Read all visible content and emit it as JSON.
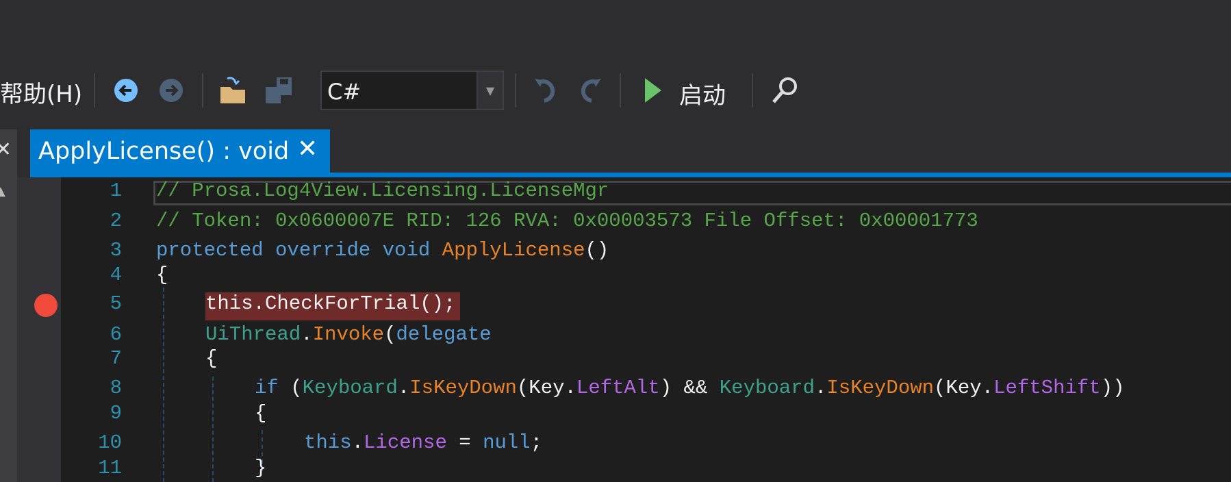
{
  "menu": {
    "help_label": "帮助(H)"
  },
  "toolbar": {
    "language_value": "C#",
    "start_label": "启动",
    "icons": [
      "back-icon",
      "forward-icon",
      "open-folder-icon",
      "save-icon",
      "undo-icon",
      "redo-icon",
      "play-icon",
      "search-icon"
    ]
  },
  "tab": {
    "title": "ApplyLicense() : void",
    "close_label": "✕"
  },
  "side": {
    "close_label": "✕",
    "up_label": "▲"
  },
  "colors": {
    "accent": "#007acc",
    "comment": "#57a64a",
    "keyword": "#569cd6",
    "method": "#e8832a",
    "type": "#4ec9b0",
    "property": "#b267e6",
    "line_number": "#2b91af",
    "breakpoint": "#f04a3a"
  },
  "code": {
    "breakpoint_line": 5,
    "lines": [
      {
        "n": "1",
        "indent": 0,
        "tokens": [
          {
            "t": "// Prosa.Log4View.Licensing.LicenseMgr",
            "c": "cm"
          }
        ]
      },
      {
        "n": "2",
        "indent": 0,
        "tokens": [
          {
            "t": "// Token: 0x0600007E RID: 126 RVA: 0x00003573 File Offset: 0x00001773",
            "c": "cm"
          }
        ]
      },
      {
        "n": "3",
        "indent": 0,
        "tokens": [
          {
            "t": "protected override void ",
            "c": "kw"
          },
          {
            "t": "ApplyLicense",
            "c": "mt"
          },
          {
            "t": "()",
            "c": "tx"
          }
        ]
      },
      {
        "n": "4",
        "indent": 0,
        "tokens": [
          {
            "t": "{",
            "c": "tx"
          }
        ]
      },
      {
        "n": "5",
        "indent": 1,
        "tokens": [
          {
            "t": "this.CheckForTrial();",
            "c": "tx"
          }
        ]
      },
      {
        "n": "6",
        "indent": 1,
        "tokens": [
          {
            "t": "UiThread",
            "c": "ty"
          },
          {
            "t": ".",
            "c": "tx"
          },
          {
            "t": "Invoke",
            "c": "mt"
          },
          {
            "t": "(",
            "c": "tx"
          },
          {
            "t": "delegate",
            "c": "kw"
          }
        ]
      },
      {
        "n": "7",
        "indent": 1,
        "tokens": [
          {
            "t": "{",
            "c": "tx"
          }
        ]
      },
      {
        "n": "8",
        "indent": 2,
        "tokens": [
          {
            "t": "if ",
            "c": "kw"
          },
          {
            "t": "(",
            "c": "tx"
          },
          {
            "t": "Keyboard",
            "c": "ty"
          },
          {
            "t": ".",
            "c": "tx"
          },
          {
            "t": "IsKeyDown",
            "c": "mt"
          },
          {
            "t": "(Key.",
            "c": "tx"
          },
          {
            "t": "LeftAlt",
            "c": "pr"
          },
          {
            "t": ") && ",
            "c": "tx"
          },
          {
            "t": "Keyboard",
            "c": "ty"
          },
          {
            "t": ".",
            "c": "tx"
          },
          {
            "t": "IsKeyDown",
            "c": "mt"
          },
          {
            "t": "(Key.",
            "c": "tx"
          },
          {
            "t": "LeftShift",
            "c": "pr"
          },
          {
            "t": "))",
            "c": "tx"
          }
        ]
      },
      {
        "n": "9",
        "indent": 2,
        "tokens": [
          {
            "t": "{",
            "c": "tx"
          }
        ]
      },
      {
        "n": "10",
        "indent": 3,
        "tokens": [
          {
            "t": "this",
            "c": "kw"
          },
          {
            "t": ".",
            "c": "tx"
          },
          {
            "t": "License",
            "c": "pr"
          },
          {
            "t": " = ",
            "c": "tx"
          },
          {
            "t": "null",
            "c": "kw"
          },
          {
            "t": ";",
            "c": "tx"
          }
        ]
      },
      {
        "n": "11",
        "indent": 2,
        "tokens": [
          {
            "t": "}",
            "c": "tx"
          }
        ]
      }
    ]
  }
}
